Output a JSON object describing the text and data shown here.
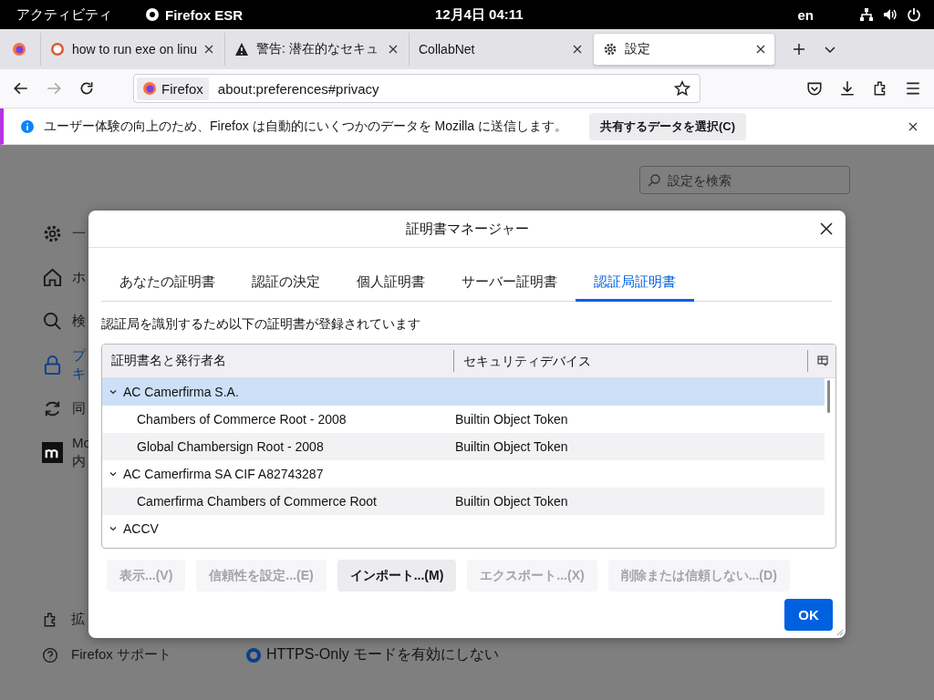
{
  "top_bar": {
    "activities": "アクティビティ",
    "app": "Firefox ESR",
    "clock": "12月4日  04:11",
    "language": "en"
  },
  "tabs": [
    {
      "title": "how to run exe on linu",
      "kind": "site",
      "selected": false
    },
    {
      "title": "警告: 潜在的なセキュ",
      "kind": "warning",
      "selected": false
    },
    {
      "title": "CollabNet",
      "kind": "plain",
      "selected": false
    },
    {
      "title": "設定",
      "kind": "settings",
      "selected": true
    }
  ],
  "nav": {
    "identity": "Firefox",
    "url": "about:preferences#privacy",
    "forward_disabled": true
  },
  "notification": {
    "message": "ユーザー体験の向上のため、Firefox は自動的にいくつかのデータを Mozilla に送信します。",
    "button": "共有するデータを選択(C)"
  },
  "preferences": {
    "search": {
      "placeholder": "設定を検索"
    },
    "sidebar": [
      {
        "lines": [
          "一"
        ],
        "selected": false
      },
      {
        "lines": [
          "ホ"
        ],
        "selected": false
      },
      {
        "lines": [
          "検"
        ],
        "selected": false
      },
      {
        "lines": [
          "プ",
          "キ"
        ],
        "selected": true
      },
      {
        "lines": [
          "同"
        ],
        "selected": false
      },
      {
        "lines": [
          "Mo",
          "内"
        ],
        "selected": false
      }
    ],
    "footer": [
      {
        "label": "拡"
      },
      {
        "label": "Firefox サポート"
      }
    ],
    "radio": {
      "label": "HTTPS-Only モードを有効にしない",
      "selected": true
    }
  },
  "dialog": {
    "title": "証明書マネージャー",
    "tabs": [
      {
        "label": "あなたの証明書",
        "selected": false
      },
      {
        "label": "認証の決定",
        "selected": false
      },
      {
        "label": "個人証明書",
        "selected": false
      },
      {
        "label": "サーバー証明書",
        "selected": false
      },
      {
        "label": "認証局証明書",
        "selected": true
      }
    ],
    "description": "認証局を識別するため以下の証明書が登録されています",
    "columns": [
      "証明書名と発行者名",
      "セキュリティデバイス"
    ],
    "rows": [
      {
        "name": "AC Camerfirma S.A.",
        "expanded": true,
        "selected": true,
        "children": [
          {
            "name": "Chambers of Commerce Root - 2008",
            "device": "Builtin Object Token",
            "selected": false
          },
          {
            "name": "Global Chambersign Root - 2008",
            "device": "Builtin Object Token",
            "selected": false
          }
        ]
      },
      {
        "name": "AC Camerfirma SA CIF A82743287",
        "expanded": true,
        "selected": false,
        "children": [
          {
            "name": "Camerfirma Chambers of Commerce Root",
            "device": "Builtin Object Token",
            "selected": false
          }
        ]
      },
      {
        "name": "ACCV",
        "expanded": true,
        "selected": false
      }
    ],
    "buttons": [
      {
        "label": "表示...(V)",
        "disabled": true
      },
      {
        "label": "信頼性を設定...(E)",
        "disabled": true
      },
      {
        "label": "インポート...(M)",
        "disabled": false
      },
      {
        "label": "エクスポート...(X)",
        "disabled": true
      },
      {
        "label": "削除または信頼しない...(D)",
        "disabled": true
      }
    ],
    "ok": "OK"
  }
}
